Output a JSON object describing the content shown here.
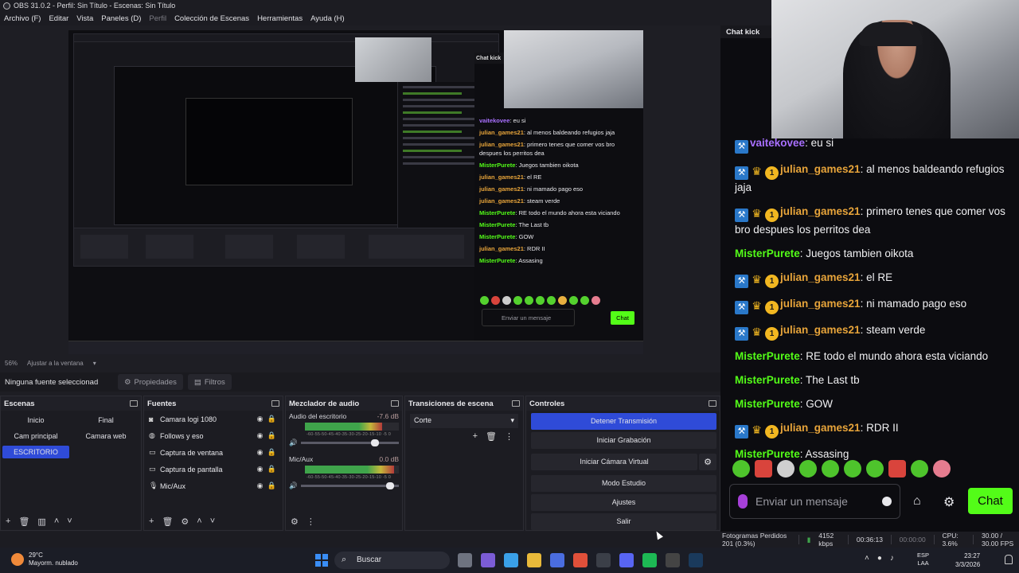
{
  "window": {
    "title": "OBS 31.0.2 - Perfil: Sin Título - Escenas: Sin Título"
  },
  "menu": [
    "Archivo (F)",
    "Editar",
    "Vista",
    "Paneles (D)",
    "Perfil",
    "Colección de Escenas",
    "Herramientas",
    "Ayuda (H)"
  ],
  "preview": {
    "zoom": "56%",
    "fit_label": "Ajustar a la ventana",
    "canvas_chat_title": "Chat kick",
    "canvas_messages": [
      {
        "user": "vaitekovee",
        "text": "eu si"
      },
      {
        "user": "julian_games21",
        "text": "al menos baldeando refugios jaja"
      },
      {
        "user": "julian_games21",
        "text": "primero tenes que comer vos bro despues los perritos dea"
      },
      {
        "user": "MisterPurete",
        "text": "Juegos tambien oikota"
      },
      {
        "user": "julian_games21",
        "text": "el RE"
      },
      {
        "user": "julian_games21",
        "text": "ni mamado pago eso"
      },
      {
        "user": "julian_games21",
        "text": "steam verde"
      },
      {
        "user": "MisterPurete",
        "text": "RE todo el mundo ahora esta viciando"
      },
      {
        "user": "MisterPurete",
        "text": "The Last tb"
      },
      {
        "user": "MisterPurete",
        "text": "GOW"
      },
      {
        "user": "julian_games21",
        "text": "RDR II"
      },
      {
        "user": "MisterPurete",
        "text": "Assasing"
      }
    ],
    "canvas_input_placeholder": "Enviar un mensaje",
    "canvas_chat_button": "Chat"
  },
  "source_bar": {
    "no_selection": "Ninguna fuente seleccionad",
    "properties": "Propiedades",
    "filters": "Filtros"
  },
  "scenes": {
    "title": "Escenas",
    "items": [
      "Inicio",
      "Final",
      "Cam principal",
      "Camara web",
      "ESCRITORIO"
    ],
    "active": "ESCRITORIO"
  },
  "sources": {
    "title": "Fuentes",
    "items": [
      {
        "name": "Camara logi 1080",
        "icon": "camera-icon"
      },
      {
        "name": "Follows y eso",
        "icon": "browser-icon"
      },
      {
        "name": "Captura de ventana",
        "icon": "window-capture-icon"
      },
      {
        "name": "Captura de pantalla",
        "icon": "monitor-icon"
      },
      {
        "name": "Mic/Aux",
        "icon": "microphone-icon"
      }
    ]
  },
  "mixer": {
    "title": "Mezclador de audio",
    "channels": [
      {
        "name": "Audio del escritorio",
        "db": "-7.6 dB",
        "level": 0.82,
        "volume": 0.8
      },
      {
        "name": "Mic/Aux",
        "db": "0.0 dB",
        "level": 0.95,
        "volume": 0.95
      }
    ],
    "ticks": "-60-55-50-45-40-35-30-25-20-15-10 -5 0"
  },
  "transitions": {
    "title": "Transiciones de escena",
    "selected": "Corte"
  },
  "controls": {
    "title": "Controles",
    "stop_stream": "Detener Transmisión",
    "start_recording": "Iniciar Grabación",
    "start_virtual_cam": "Iniciar Cámara Virtual",
    "studio_mode": "Modo Estudio",
    "settings": "Ajustes",
    "exit": "Salir"
  },
  "chat": {
    "title": "Chat kick",
    "messages": [
      {
        "badges": [
          "mod"
        ],
        "user": "vaitekovee",
        "color": "#a970ff",
        "text": "eu si"
      },
      {
        "badges": [
          "mod",
          "crown",
          "coin"
        ],
        "user": "julian_games21",
        "color": "#e7a43a",
        "text": "al menos baldeando refugios jaja"
      },
      {
        "badges": [
          "mod",
          "crown",
          "coin"
        ],
        "user": "julian_games21",
        "color": "#e7a43a",
        "text": "primero tenes que comer vos bro despues los perritos dea"
      },
      {
        "badges": [],
        "user": "MisterPurete",
        "color": "#53fc18",
        "text": "Juegos tambien oikota"
      },
      {
        "badges": [
          "mod",
          "crown",
          "coin"
        ],
        "user": "julian_games21",
        "color": "#e7a43a",
        "text": "el RE"
      },
      {
        "badges": [
          "mod",
          "crown",
          "coin"
        ],
        "user": "julian_games21",
        "color": "#e7a43a",
        "text": "ni mamado pago eso"
      },
      {
        "badges": [
          "mod",
          "crown",
          "coin"
        ],
        "user": "julian_games21",
        "color": "#e7a43a",
        "text": "steam verde"
      },
      {
        "badges": [],
        "user": "MisterPurete",
        "color": "#53fc18",
        "text": "RE todo el mundo ahora esta viciando"
      },
      {
        "badges": [],
        "user": "MisterPurete",
        "color": "#53fc18",
        "text": "The Last tb"
      },
      {
        "badges": [],
        "user": "MisterPurete",
        "color": "#53fc18",
        "text": "GOW"
      },
      {
        "badges": [
          "mod",
          "crown",
          "coin"
        ],
        "user": "julian_games21",
        "color": "#e7a43a",
        "text": "RDR II"
      },
      {
        "badges": [],
        "user": "MisterPurete",
        "color": "#53fc18",
        "text": "Assasing"
      }
    ],
    "input_placeholder": "Enviar un mensaje",
    "send_label": "Chat",
    "accent": "#53fc18"
  },
  "status": {
    "dropped": "Fotogramas Perdidos 201 (0.3%)",
    "bitrate": "4152 kbps",
    "stream_time": "00:36:13",
    "rec_time": "00:00:00",
    "cpu": "CPU: 3.6%",
    "fps": "30.00 / 30.00 FPS"
  },
  "taskbar": {
    "temp": "29°C",
    "weather": "Mayorm. nublado",
    "search": "Buscar",
    "lang1": "ESP",
    "lang2": "LAA",
    "time": "23:27",
    "date": "3/3/2026"
  },
  "colors": {
    "obs_blue": "#2f4bd8",
    "kick_green": "#53fc18"
  }
}
